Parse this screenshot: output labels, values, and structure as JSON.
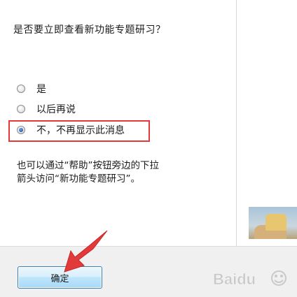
{
  "dialog": {
    "question": "是否要立即查看新功能专题研习？",
    "options": [
      {
        "label": "是",
        "checked": false
      },
      {
        "label": "以后再说",
        "checked": false
      },
      {
        "label": "不，不再显示此消息",
        "checked": true
      }
    ],
    "hint_line1": "也可以通过“帮助”按钮旁边的下拉",
    "hint_line2": "箭头访问“新功能专题研习”。",
    "ok_label": "确定"
  },
  "colors": {
    "highlight": "#e23a3a",
    "arrow": "#e23a3a",
    "button_border": "#3c7fb1"
  },
  "watermark": {
    "text": "Baidu"
  }
}
